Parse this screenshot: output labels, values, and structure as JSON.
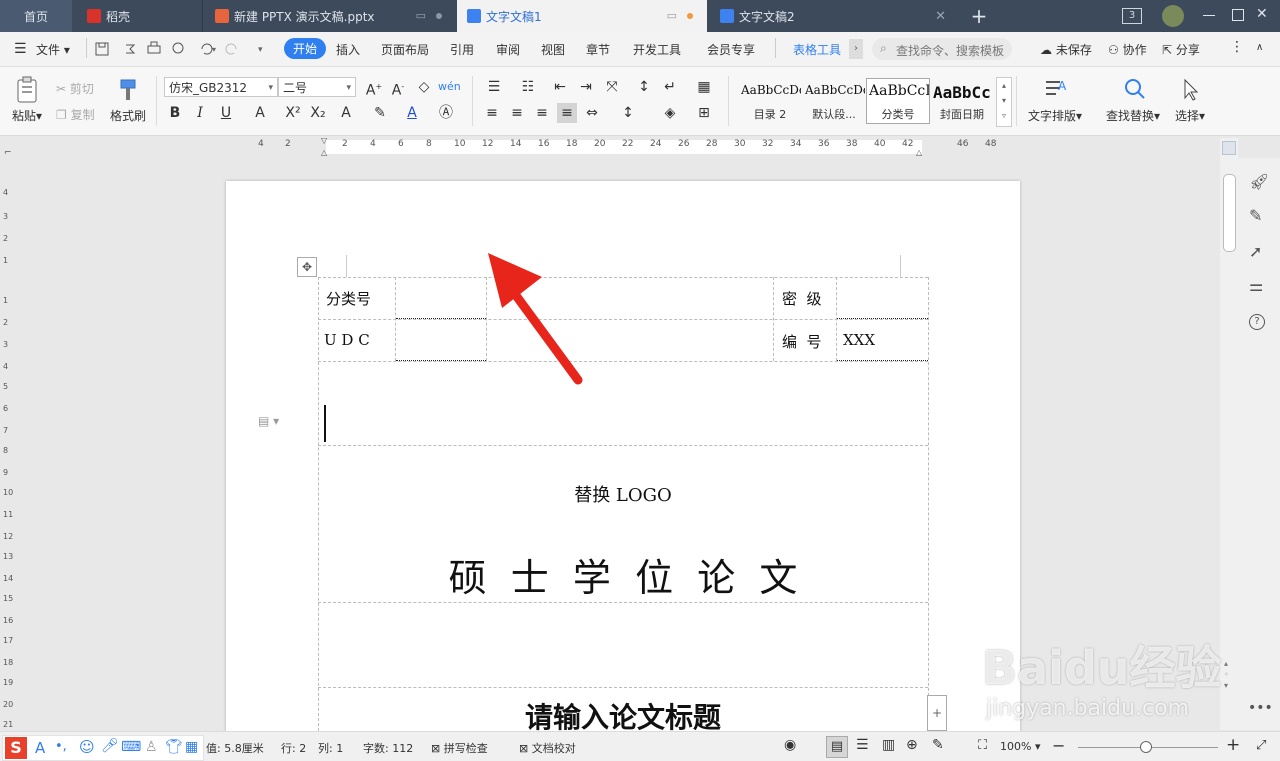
{
  "tabs": [
    {
      "label": "首页"
    },
    {
      "label": "稻壳"
    },
    {
      "label": "新建 PPTX 演示文稿.pptx"
    },
    {
      "label": "文字文稿1"
    },
    {
      "label": "文字文稿2"
    }
  ],
  "window": {
    "doc_count": "3"
  },
  "menu": {
    "file": "文件",
    "items": [
      "开始",
      "插入",
      "页面布局",
      "引用",
      "审阅",
      "视图",
      "章节",
      "开发工具",
      "会员专享",
      "表格工具"
    ],
    "search_placeholder": "查找命令、搜索模板",
    "unsaved": "未保存",
    "collab": "协作",
    "share": "分享"
  },
  "ribbon": {
    "paste": "粘贴",
    "cut": "剪切",
    "copy": "复制",
    "format_painter": "格式刷",
    "font_name": "仿宋_GB2312",
    "font_size": "二号",
    "styles": [
      {
        "preview": "AaBbCcDd",
        "name": "目录 2"
      },
      {
        "preview": "AaBbCcDd",
        "name": "默认段..."
      },
      {
        "preview": "AaBbCcI",
        "name": "分类号"
      },
      {
        "preview": "AaBbCc",
        "name": "封面日期"
      }
    ],
    "text_layout": "文字排版",
    "find_replace": "查找替换",
    "select": "选择"
  },
  "ruler": {
    "h": [
      "4",
      "2",
      "2",
      "4",
      "6",
      "8",
      "10",
      "12",
      "14",
      "16",
      "18",
      "20",
      "22",
      "24",
      "26",
      "28",
      "30",
      "32",
      "34",
      "36",
      "38",
      "40",
      "42",
      "46",
      "48"
    ],
    "v": [
      "4",
      "3",
      "2",
      "1",
      "1",
      "2",
      "3",
      "4",
      "5",
      "6",
      "7",
      "8",
      "9",
      "10",
      "11",
      "12",
      "13",
      "14",
      "15",
      "16",
      "17",
      "18",
      "19",
      "20",
      "21"
    ]
  },
  "document": {
    "classification_label": "分类号",
    "secret_label": "密  级",
    "udc_label": "U D C",
    "number_label": "编  号",
    "number_value": "XXX",
    "logo_text": "替换 LOGO",
    "degree_title": "硕  士  学  位  论  文",
    "thesis_title_placeholder": "请输入论文标题"
  },
  "status": {
    "position": "值: 5.8厘米",
    "row": "行: 2",
    "col": "列: 1",
    "word_count": "字数: 112",
    "spell_check": "拼写检查",
    "doc_proof": "文档校对",
    "zoom": "100%"
  },
  "watermark": {
    "text": "Baidu经验",
    "url": "jingyan.baidu.com"
  },
  "colors": {
    "accent": "#2f7ff0",
    "titlebar": "#3d4a5c",
    "arrow": "#e8251b"
  }
}
